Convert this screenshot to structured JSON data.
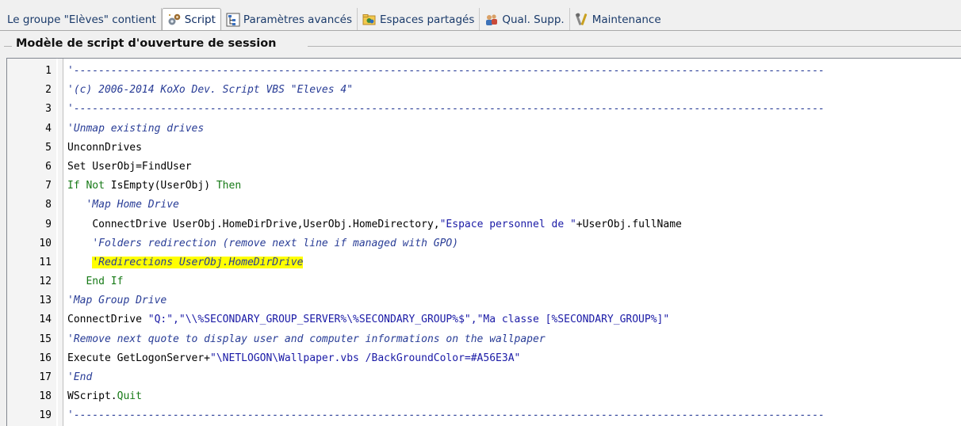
{
  "tabs": [
    {
      "label": "Le groupe \"Elèves\" contient",
      "icon": "none"
    },
    {
      "label": "Script",
      "icon": "gears-icon",
      "active": true
    },
    {
      "label": "Paramètres avancés",
      "icon": "tree-settings-icon"
    },
    {
      "label": "Espaces partagés",
      "icon": "shared-folders-icon"
    },
    {
      "label": "Qual. Supp.",
      "icon": "users-icon"
    },
    {
      "label": "Maintenance",
      "icon": "tools-icon"
    }
  ],
  "group_title": "Modèle de script d'ouverture de session",
  "editor": {
    "lines": [
      {
        "n": "1",
        "indent": "",
        "tokens": [
          {
            "t": "'-------------------------------------------------------------------------------------------------------------------------",
            "c": "comment"
          }
        ]
      },
      {
        "n": "2",
        "indent": "",
        "tokens": [
          {
            "t": "'(c) 2006-2014 KoXo Dev. Script VBS \"Eleves 4\"",
            "c": "comment"
          }
        ]
      },
      {
        "n": "3",
        "indent": "",
        "tokens": [
          {
            "t": "'-------------------------------------------------------------------------------------------------------------------------",
            "c": "comment"
          }
        ]
      },
      {
        "n": "4",
        "indent": "",
        "tokens": [
          {
            "t": "'Unmap existing drives",
            "c": "comment"
          }
        ]
      },
      {
        "n": "5",
        "indent": "",
        "tokens": [
          {
            "t": "UnconnDrives",
            "c": "plain"
          }
        ]
      },
      {
        "n": "6",
        "indent": "",
        "tokens": [
          {
            "t": "Set UserObj=FindUser",
            "c": "plain"
          }
        ]
      },
      {
        "n": "7",
        "indent": "",
        "tokens": [
          {
            "t": "If Not ",
            "c": "kw"
          },
          {
            "t": "IsEmpty(UserObj) ",
            "c": "plain"
          },
          {
            "t": "Then",
            "c": "kw"
          }
        ]
      },
      {
        "n": "8",
        "indent": "   ",
        "tokens": [
          {
            "t": "'Map Home Drive",
            "c": "comment"
          }
        ]
      },
      {
        "n": "9",
        "indent": "    ",
        "tokens": [
          {
            "t": "ConnectDrive UserObj.HomeDirDrive,UserObj.HomeDirectory,",
            "c": "plain"
          },
          {
            "t": "\"Espace personnel de \"",
            "c": "str"
          },
          {
            "t": "+UserObj.fullName",
            "c": "plain"
          }
        ]
      },
      {
        "n": "10",
        "indent": "    ",
        "tokens": [
          {
            "t": "'Folders redirection (remove next line if managed with GPO)",
            "c": "comment"
          }
        ]
      },
      {
        "n": "11",
        "indent": "    ",
        "tokens": [
          {
            "t": "'Redirections UserObj.HomeDirDrive",
            "c": "comment",
            "hl": true
          }
        ]
      },
      {
        "n": "12",
        "indent": "   ",
        "tokens": [
          {
            "t": "End If",
            "c": "kw"
          }
        ]
      },
      {
        "n": "13",
        "indent": "",
        "tokens": [
          {
            "t": "'Map Group Drive",
            "c": "comment"
          }
        ]
      },
      {
        "n": "14",
        "indent": "",
        "tokens": [
          {
            "t": "ConnectDrive ",
            "c": "plain"
          },
          {
            "t": "\"Q:\",\"\\\\%SECONDARY_GROUP_SERVER%\\%SECONDARY_GROUP%$\",\"Ma classe [%SECONDARY_GROUP%]\"",
            "c": "str"
          }
        ]
      },
      {
        "n": "15",
        "indent": "",
        "tokens": [
          {
            "t": "'Remove next quote to display user and computer informations on the wallpaper",
            "c": "comment"
          }
        ]
      },
      {
        "n": "16",
        "indent": "",
        "tokens": [
          {
            "t": "Execute GetLogonServer+",
            "c": "plain"
          },
          {
            "t": "\"\\NETLOGON\\Wallpaper.vbs /BackGroundColor=#A56E3A\"",
            "c": "str"
          }
        ]
      },
      {
        "n": "17",
        "indent": "",
        "tokens": [
          {
            "t": "'End",
            "c": "comment"
          }
        ]
      },
      {
        "n": "18",
        "indent": "",
        "tokens": [
          {
            "t": "WScript.",
            "c": "plain"
          },
          {
            "t": "Quit",
            "c": "kw"
          }
        ]
      },
      {
        "n": "19",
        "indent": "",
        "tokens": [
          {
            "t": "'-------------------------------------------------------------------------------------------------------------------------",
            "c": "comment"
          }
        ]
      }
    ]
  },
  "colors": {
    "comment": "#283c96",
    "keyword": "#177a17",
    "string": "#1a1aa6",
    "highlight": "#ffff00"
  }
}
